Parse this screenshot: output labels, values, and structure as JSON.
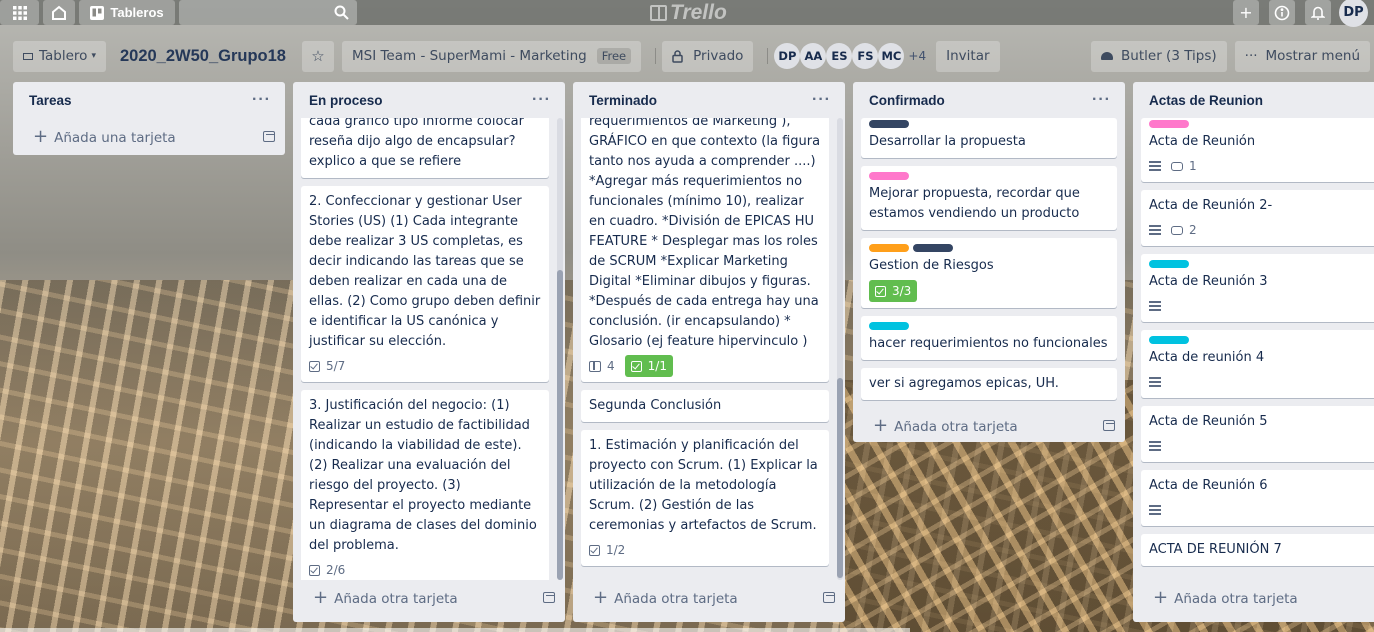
{
  "topbar": {
    "boards_label": "Tableros",
    "logo_text": "Trello",
    "user_initials": "DP"
  },
  "board": {
    "view_label": "Tablero",
    "title": "2020_2W50_Grupo18",
    "team": "MSI Team - SuperMami - Marketing",
    "plan": "Free",
    "visibility": "Privado",
    "members": [
      "DP",
      "AA",
      "ES",
      "FS",
      "MC"
    ],
    "more_members": "+4",
    "invite_label": "Invitar",
    "butler_label": "Butler (3 Tips)",
    "menu_label": "Mostrar menú"
  },
  "colors": {
    "green": "#61bd4f",
    "pink": "#ff78cb",
    "navy": "#344563",
    "orange": "#ff9f1a",
    "sky": "#00c2e0"
  },
  "lists": [
    {
      "title": "Tareas",
      "add_label": "Añada una tarjeta",
      "cards": []
    },
    {
      "title": "En proceso",
      "add_label": "Añada otra tarjeta",
      "cards": [
        {
          "text": "cada gráfico tipo informe colocar reseña dijo algo de encapsular? explico a que se refiere"
        },
        {
          "text": "2. Confeccionar y gestionar User Stories (US) (1) Cada integrante debe realizar 3 US completas, es decir indicando las tareas que se deben realizar en cada una de ellas. (2) Como grupo deben definir e identificar la US canónica y justificar su elección.",
          "checklist": "5/7"
        },
        {
          "text": "3. Justificación del negocio: (1) Realizar un estudio de factibilidad (indicando la viabilidad de este). (2) Realizar una evaluación del riesgo del proyecto. (3) Representar el proyecto mediante un diagrama de clases del dominio del problema.",
          "checklist": "2/6"
        }
      ]
    },
    {
      "title": "Terminado",
      "add_label": "Añada otra tarjeta",
      "cards": [
        {
          "text": "requerimientos de Marketing ), GRÁFICO en que contexto (la figura tanto nos ayuda a comprender ....) *Agregar más requerimientos no funcionales (mínimo 10), realizar en cuadro. *División de EPICAS HU FEATURE * Desplegar mas los roles de SCRUM *Explicar Marketing Digital *Eliminar dibujos y figuras. *Después de cada entrega hay una conclusión. (ir encapsulando) * Glosario (ej feature hipervinculo )",
          "attachments": "4",
          "checklist": "1/1"
        },
        {
          "text": "Segunda Conclusión"
        },
        {
          "text": "1. Estimación y planificación del proyecto con Scrum. (1) Explicar la utilización de la metodología Scrum. (2) Gestión de las ceremonias y artefactos de Scrum.",
          "checklist": "1/2"
        }
      ]
    },
    {
      "title": "Confirmado",
      "add_label": "Añada otra tarjeta",
      "cards": [
        {
          "text": "Desarrollar la propuesta",
          "labels": [
            "navy"
          ]
        },
        {
          "text": "Mejorar propuesta, recordar que estamos vendiendo un producto",
          "labels": [
            "pink"
          ]
        },
        {
          "text": "Gestion de Riesgos",
          "labels": [
            "orange",
            "navy"
          ],
          "checklist": "3/3"
        },
        {
          "text": "hacer requerimientos no funcionales",
          "labels": [
            "sky"
          ]
        },
        {
          "text": "ver si agregamos epicas, UH."
        }
      ]
    },
    {
      "title": "Actas de Reunion",
      "add_label": "Añada otra tarjeta",
      "cards": [
        {
          "text": "Acta de Reunión",
          "labels": [
            "pink"
          ],
          "comments": "1"
        },
        {
          "text": "Acta de Reunión 2-",
          "comments": "2"
        },
        {
          "text": "Acta de Reunión 3",
          "labels": [
            "sky"
          ]
        },
        {
          "text": "Acta de reunión 4",
          "labels": [
            "sky"
          ]
        },
        {
          "text": "Acta de Reunión 5"
        },
        {
          "text": "Acta de Reunión 6"
        },
        {
          "text": "ACTA DE REUNIÓN 7"
        }
      ]
    }
  ]
}
